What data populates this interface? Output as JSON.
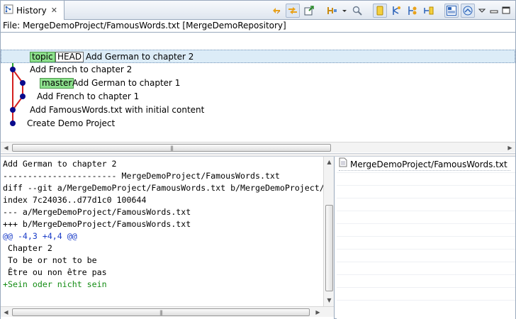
{
  "view": {
    "tab_title": "History",
    "tab_close": "✕",
    "toolbar_icons": [
      "link-with-selection-icon",
      "link-with-editor-icon",
      "show-in-repository-icon",
      "compare-mode-icon",
      "view-menu-dropdown-icon",
      "find-icon",
      "show-all-branches-icon",
      "show-all-commits-icon",
      "filter-resource-icon",
      "filter-folder-icon",
      "layout-horizontal-icon",
      "layout-vertical-icon",
      "view-menu-icon",
      "minimize-icon"
    ]
  },
  "file_label": "File: MergeDemoProject/FamousWords.txt [MergeDemoRepository]",
  "commits": [
    {
      "refs": [
        {
          "type": "branch",
          "label": "topic"
        },
        {
          "type": "head",
          "label": "HEAD"
        }
      ],
      "message": "Add German to chapter 2",
      "selected": true
    },
    {
      "refs": [],
      "message": "Add French to chapter 2",
      "selected": false
    },
    {
      "refs": [
        {
          "type": "branch",
          "label": "master"
        }
      ],
      "message": "Add German to chapter 1",
      "selected": false
    },
    {
      "refs": [],
      "message": "Add French to chapter 1",
      "selected": false
    },
    {
      "refs": [],
      "message": "Add FamousWords.txt with initial content",
      "selected": false
    },
    {
      "refs": [],
      "message": "Create Demo Project",
      "selected": false
    }
  ],
  "diff": [
    {
      "kind": "text",
      "text": "Add German to chapter 2"
    },
    {
      "kind": "text",
      "text": "----------------------- MergeDemoProject/FamousWords.txt"
    },
    {
      "kind": "text",
      "text": "diff --git a/MergeDemoProject/FamousWords.txt b/MergeDemoProject/FamousWords.txt"
    },
    {
      "kind": "text",
      "text": "index 7c24036..d77d1c0 100644"
    },
    {
      "kind": "text",
      "text": "--- a/MergeDemoProject/FamousWords.txt"
    },
    {
      "kind": "text",
      "text": "+++ b/MergeDemoProject/FamousWords.txt"
    },
    {
      "kind": "hunk",
      "text": "@@ -4,3 +4,4 @@"
    },
    {
      "kind": "text",
      "text": " Chapter 2"
    },
    {
      "kind": "text",
      "text": " To be or not to be"
    },
    {
      "kind": "text",
      "text": " Être ou non être pas"
    },
    {
      "kind": "add",
      "text": "+Sein oder nicht sein"
    }
  ],
  "changed_files": [
    "MergeDemoProject/FamousWords.txt"
  ],
  "colors": {
    "branch_label": "#8de08d",
    "commit_dot": "#0a0a8c",
    "lane_green": "#2aa52a",
    "lane_red": "#d42020",
    "hunk": "#1a3cc8",
    "added": "#138c13"
  }
}
